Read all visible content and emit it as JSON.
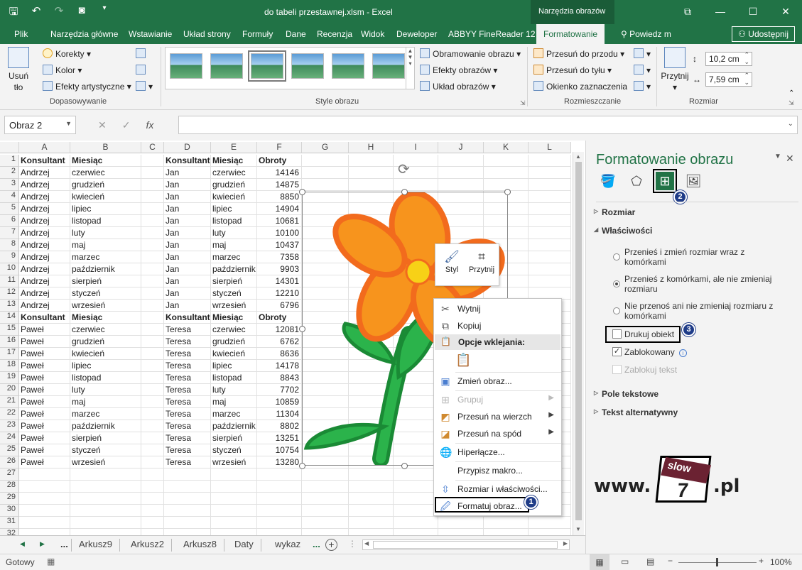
{
  "window": {
    "title": "do tabeli przestawnej.xlsm - Excel",
    "context_tab_group": "Narzędzia obrazów",
    "controls": {
      "ribbon_options": "⧉",
      "minimize": "—",
      "maximize": "☐",
      "close": "✕"
    }
  },
  "tabs": [
    {
      "label": "Plik"
    },
    {
      "label": "Narzędzia główne"
    },
    {
      "label": "Wstawianie"
    },
    {
      "label": "Układ strony"
    },
    {
      "label": "Formuły"
    },
    {
      "label": "Dane"
    },
    {
      "label": "Recenzja"
    },
    {
      "label": "Widok"
    },
    {
      "label": "Deweloper"
    },
    {
      "label": "ABBYY FineReader 12"
    },
    {
      "label": "Formatowanie"
    },
    {
      "label": "Powiedz m"
    }
  ],
  "share_label": "Udostępnij",
  "ribbon": {
    "adjust": {
      "remove_bg": "Usuń tło",
      "corrections": "Korekty",
      "color": "Kolor",
      "artistic": "Efekty artystyczne",
      "group": "Dopasowywanie"
    },
    "styles": {
      "border": "Obramowanie obrazu",
      "effects": "Efekty obrazów",
      "layout": "Układ obrazów",
      "group": "Style obrazu"
    },
    "arrange": {
      "forward": "Przesuń do przodu",
      "backward": "Przesuń do tyłu",
      "selection_pane": "Okienko zaznaczenia",
      "group": "Rozmieszczanie"
    },
    "size": {
      "crop": "Przytnij",
      "height": "10,2 cm",
      "width": "7,59 cm",
      "group": "Rozmiar"
    }
  },
  "formula_bar": {
    "name_box": "Obraz 2",
    "fx": "fx",
    "value": ""
  },
  "columns": [
    "A",
    "B",
    "C",
    "D",
    "E",
    "F",
    "G",
    "H",
    "I",
    "J",
    "K",
    "L"
  ],
  "rows": [
    [
      "Konsultant",
      "Miesiąc",
      "",
      "Konsultant",
      "Miesiąc",
      "Obroty"
    ],
    [
      "Andrzej",
      "czerwiec",
      "",
      "Jan",
      "czerwiec",
      "14146"
    ],
    [
      "Andrzej",
      "grudzień",
      "",
      "Jan",
      "grudzień",
      "14875"
    ],
    [
      "Andrzej",
      "kwiecień",
      "",
      "Jan",
      "kwiecień",
      "8850"
    ],
    [
      "Andrzej",
      "lipiec",
      "",
      "Jan",
      "lipiec",
      "14904"
    ],
    [
      "Andrzej",
      "listopad",
      "",
      "Jan",
      "listopad",
      "10681"
    ],
    [
      "Andrzej",
      "luty",
      "",
      "Jan",
      "luty",
      "10100"
    ],
    [
      "Andrzej",
      "maj",
      "",
      "Jan",
      "maj",
      "10437"
    ],
    [
      "Andrzej",
      "marzec",
      "",
      "Jan",
      "marzec",
      "7358"
    ],
    [
      "Andrzej",
      "październik",
      "",
      "Jan",
      "październik",
      "9903"
    ],
    [
      "Andrzej",
      "sierpień",
      "",
      "Jan",
      "sierpień",
      "14301"
    ],
    [
      "Andrzej",
      "styczeń",
      "",
      "Jan",
      "styczeń",
      "12210"
    ],
    [
      "Andrzej",
      "wrzesień",
      "",
      "Jan",
      "wrzesień",
      "6796"
    ],
    [
      "Konsultant",
      "Miesiąc",
      "",
      "Konsultant",
      "Miesiąc",
      "Obroty"
    ],
    [
      "Paweł",
      "czerwiec",
      "",
      "Teresa",
      "czerwiec",
      "12081"
    ],
    [
      "Paweł",
      "grudzień",
      "",
      "Teresa",
      "grudzień",
      "6762"
    ],
    [
      "Paweł",
      "kwiecień",
      "",
      "Teresa",
      "kwiecień",
      "8636"
    ],
    [
      "Paweł",
      "lipiec",
      "",
      "Teresa",
      "lipiec",
      "14178"
    ],
    [
      "Paweł",
      "listopad",
      "",
      "Teresa",
      "listopad",
      "8843"
    ],
    [
      "Paweł",
      "luty",
      "",
      "Teresa",
      "luty",
      "7702"
    ],
    [
      "Paweł",
      "maj",
      "",
      "Teresa",
      "maj",
      "10859"
    ],
    [
      "Paweł",
      "marzec",
      "",
      "Teresa",
      "marzec",
      "11304"
    ],
    [
      "Paweł",
      "październik",
      "",
      "Teresa",
      "październik",
      "8802"
    ],
    [
      "Paweł",
      "sierpień",
      "",
      "Teresa",
      "sierpień",
      "13251"
    ],
    [
      "Paweł",
      "styczeń",
      "",
      "Teresa",
      "styczeń",
      "10754"
    ],
    [
      "Paweł",
      "wrzesień",
      "",
      "Teresa",
      "wrzesień",
      "13280"
    ],
    [],
    [],
    [],
    [],
    [],
    []
  ],
  "header_rows": [
    1,
    14
  ],
  "mini_toolbar": {
    "style": "Styl",
    "crop": "Przytnij"
  },
  "context_menu": [
    {
      "label": "Wytnij",
      "icon": "scissors-icon",
      "enabled": true
    },
    {
      "label": "Kopiuj",
      "icon": "copy-icon",
      "enabled": true
    },
    {
      "label": "Opcje wklejania:",
      "icon": "paste-icon",
      "header": true
    },
    {
      "label": "Zmień obraz...",
      "icon": "change-picture-icon",
      "enabled": true
    },
    {
      "label": "Grupuj",
      "icon": "group-icon",
      "enabled": false,
      "submenu": true
    },
    {
      "label": "Przesuń na wierzch",
      "icon": "bring-front-icon",
      "enabled": true,
      "submenu": true
    },
    {
      "label": "Przesuń na spód",
      "icon": "send-back-icon",
      "enabled": true,
      "submenu": true
    },
    {
      "label": "Hiperłącze...",
      "icon": "hyperlink-icon",
      "enabled": true
    },
    {
      "label": "Przypisz makro...",
      "icon": "",
      "enabled": true
    },
    {
      "label": "Rozmiar i właściwości...",
      "icon": "size-icon",
      "enabled": true
    },
    {
      "label": "Formatuj obraz...",
      "icon": "format-picture-icon",
      "enabled": true
    }
  ],
  "badges": [
    "1",
    "2",
    "3"
  ],
  "sheets": [
    "Arkusz9",
    "Arkusz2",
    "Arkusz8",
    "Daty",
    "wykaz"
  ],
  "sheet_nav": {
    "ellipsis": "...",
    "ellipsis_right": "..."
  },
  "status": {
    "ready": "Gotowy",
    "zoom": "100%"
  },
  "pane": {
    "title": "Formatowanie obrazu",
    "sections": {
      "size": "Rozmiar",
      "properties": "Właściwości",
      "textbox": "Pole tekstowe",
      "alt_text": "Tekst alternatywny"
    },
    "options": {
      "move_resize_1": "Przenieś i zmień rozmiar wraz z",
      "move_resize_2": "komórkami",
      "move_only_1": "Przenieś z komórkami, ale nie zmieniaj",
      "move_only_2": "rozmiaru",
      "dont_move_1": "Nie przenoś ani nie zmieniaj rozmiaru z",
      "dont_move_2": "komórkami",
      "print": "Drukuj obiekt",
      "locked": "Zablokowany",
      "lock_text": "Zablokuj tekst"
    }
  },
  "logo": {
    "prefix": "www.",
    "tag": "slow",
    "num": "7",
    "suffix": ".pl"
  },
  "colors": {
    "excel_green": "#217346",
    "petal": "#f7941d",
    "petal_edge": "#f26b1d",
    "center": "#f7d117",
    "stem": "#2bb34b",
    "stem_edge": "#1a8a35",
    "badge": "#1f3c88"
  }
}
